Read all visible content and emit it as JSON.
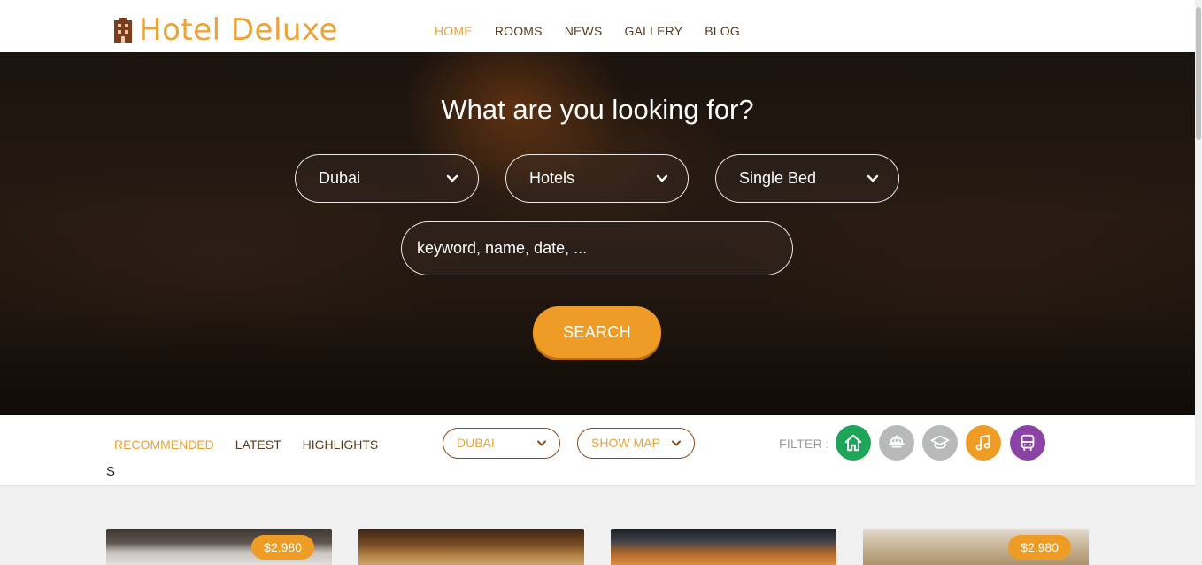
{
  "brand": {
    "name": "Hotel Deluxe",
    "accent": "#e8a33a",
    "icon": "building-icon"
  },
  "nav": {
    "items": [
      {
        "label": "HOME",
        "active": true
      },
      {
        "label": "ROOMS",
        "active": false
      },
      {
        "label": "NEWS",
        "active": false
      },
      {
        "label": "GALLERY",
        "active": false
      },
      {
        "label": "BLOG",
        "active": false
      }
    ]
  },
  "hero": {
    "title": "What are you looking for?",
    "location_select": "Dubai",
    "type_select": "Hotels",
    "bed_select": "Single Bed",
    "search_placeholder": "keyword, name, date, ...",
    "search_button": "SEARCH"
  },
  "filter_bar": {
    "tabs": [
      {
        "label": "RECOMMENDED",
        "active": true
      },
      {
        "label": "LATEST",
        "active": false
      },
      {
        "label": "HIGHLIGHTS",
        "active": false
      }
    ],
    "tab_overflow": "S",
    "city_dropdown": "DUBAI",
    "map_dropdown": "SHOW MAP",
    "filter_label": "FILTER :",
    "filter_icons": [
      {
        "icon": "home-icon",
        "color": "#1fa55a"
      },
      {
        "icon": "restaurant-icon",
        "color": "#b8b9b9"
      },
      {
        "icon": "graduation-cap-icon",
        "color": "#b8b9b9"
      },
      {
        "icon": "music-icon",
        "color": "#ee9c25"
      },
      {
        "icon": "bus-icon",
        "color": "#8b44a5"
      }
    ]
  },
  "listings": [
    {
      "price": "$2.980"
    },
    {
      "price": ""
    },
    {
      "price": ""
    },
    {
      "price": "$2.980"
    }
  ]
}
